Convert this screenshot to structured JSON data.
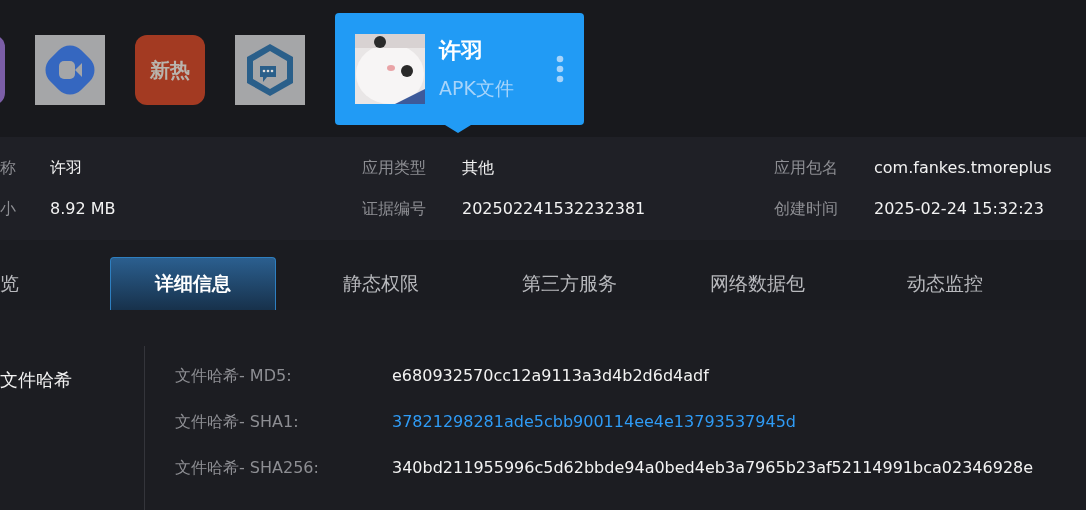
{
  "apps": [
    {
      "kind": "purple"
    },
    {
      "kind": "video"
    },
    {
      "kind": "text",
      "label": "新热"
    },
    {
      "kind": "chat"
    }
  ],
  "selected_app": {
    "name": "许羽",
    "type": "APK文件"
  },
  "info": [
    {
      "label": "称",
      "value": "许羽"
    },
    {
      "label": "应用类型",
      "value": "其他"
    },
    {
      "label": "应用包名",
      "value": "com.fankes.tmoreplus"
    },
    {
      "label": "小",
      "value": "8.92 MB"
    },
    {
      "label": "证据编号",
      "value": "202502241532232381"
    },
    {
      "label": "创建时间",
      "value": "2025-02-24 15:32:23"
    }
  ],
  "tabs": [
    {
      "label": "览",
      "selected": false
    },
    {
      "label": "详细信息",
      "selected": true
    },
    {
      "label": "静态权限",
      "selected": false
    },
    {
      "label": "第三方服务",
      "selected": false
    },
    {
      "label": "网络数据包",
      "selected": false
    },
    {
      "label": "动态监控",
      "selected": false
    }
  ],
  "section": {
    "title": "文件哈希",
    "rows": [
      {
        "label": "文件哈希- MD5:",
        "value": "e680932570cc12a9113a3d4b2d6d4adf",
        "link": false
      },
      {
        "label": "文件哈希- SHA1:",
        "value": "37821298281ade5cbb900114ee4e13793537945d",
        "link": true
      },
      {
        "label": "文件哈希- SHA256:",
        "value": "340bd211955996c5d62bbde94a0bed4eb3a7965b23af52114991bca02346928e",
        "link": false
      }
    ]
  }
}
